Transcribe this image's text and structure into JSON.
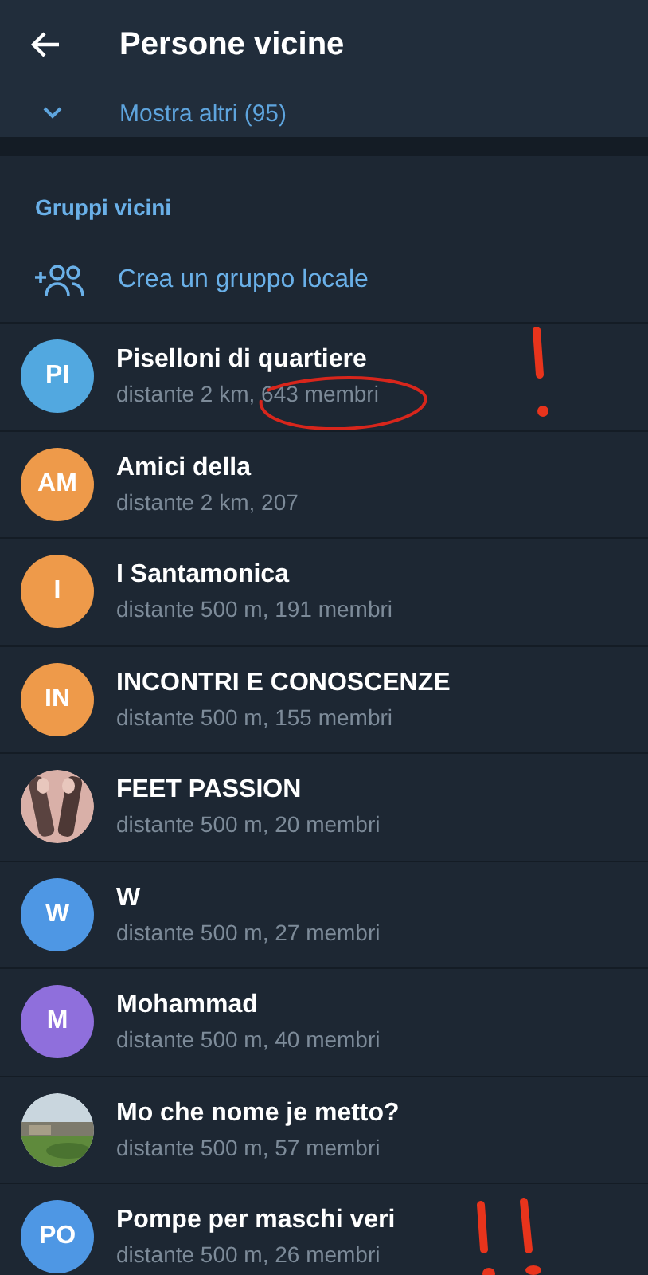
{
  "header": {
    "title": "Persone vicine"
  },
  "show_more": {
    "label": "Mostra altri (95)"
  },
  "section": {
    "title": "Gruppi vicini",
    "create_label": "Crea un gruppo locale"
  },
  "groups": [
    {
      "avatar": {
        "kind": "initials",
        "text": "PI",
        "color": "#52a8e0"
      },
      "name": "Piselloni di quartiere",
      "info": "distante 2 km, 643 membri",
      "annotation": {
        "kind": "circle"
      }
    },
    {
      "avatar": {
        "kind": "initials",
        "text": "AM",
        "color": "#ee9a4a"
      },
      "name": "Amici della",
      "info": "distante 2 km, 207"
    },
    {
      "avatar": {
        "kind": "initials",
        "text": "I",
        "color": "#ee9a4a"
      },
      "name": "I Santamonica",
      "info": "distante 500 m, 191 membri"
    },
    {
      "avatar": {
        "kind": "initials",
        "text": "IN",
        "color": "#ee9a4a"
      },
      "name": "INCONTRI E CONOSCENZE",
      "info": "distante 500 m, 155 membri"
    },
    {
      "name": "FEET PASSION",
      "info": "distante 500 m, 20 membri"
    },
    {
      "avatar": {
        "kind": "initials",
        "text": "W",
        "color": "#4e97e4"
      },
      "name": "W",
      "info": "distante 500 m, 27 membri"
    },
    {
      "avatar": {
        "kind": "initials",
        "text": "M",
        "color": "#8f6fdc"
      },
      "name": "Mohammad",
      "info": "distante 500 m, 40 membri"
    },
    {
      "name": "Mo che nome je metto?",
      "info": "distante 500 m, 57 membri"
    },
    {
      "avatar": {
        "kind": "initials",
        "text": "PO",
        "color": "#4e97e4"
      },
      "name": "Pompe per maschi veri",
      "info": "distante 500 m, 26 membri",
      "annotation": {
        "kind": "double_exclamation"
      }
    }
  ]
}
